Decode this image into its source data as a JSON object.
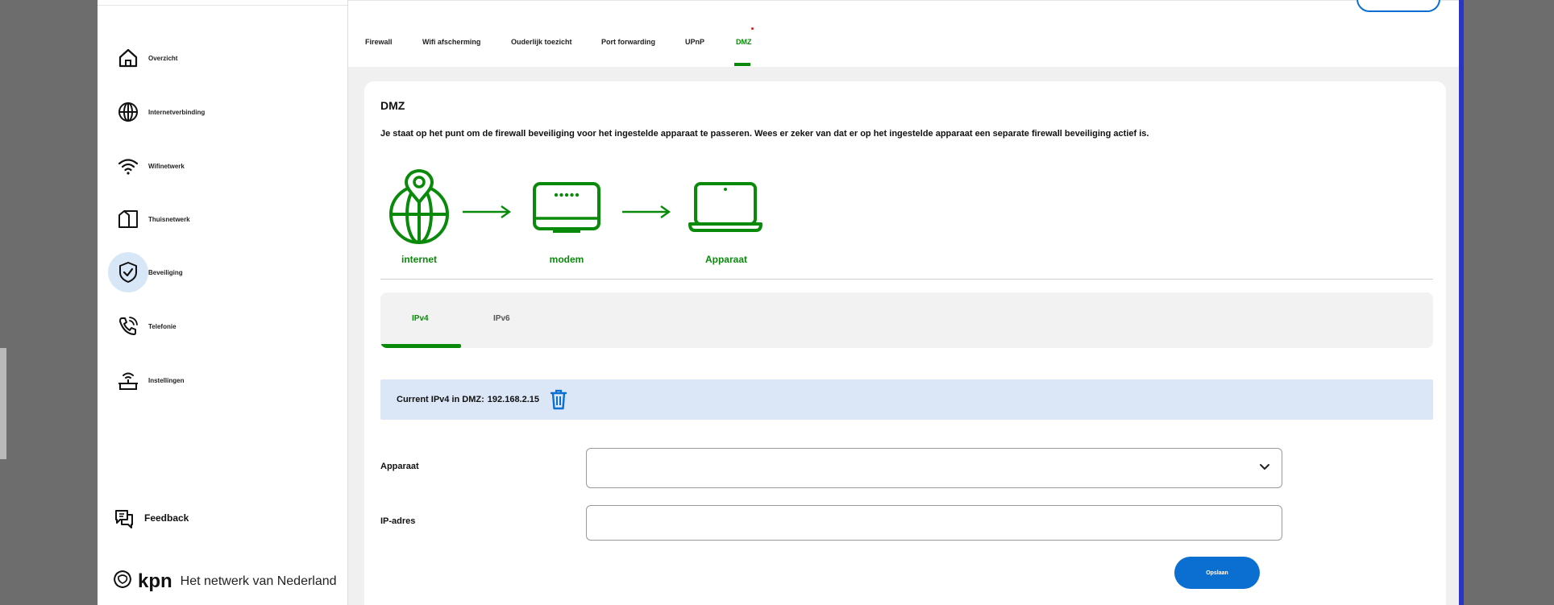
{
  "sidebar": {
    "items": [
      {
        "label": "Overzicht",
        "icon": "home-icon",
        "active": false
      },
      {
        "label": "Internetverbinding",
        "icon": "globe-icon",
        "active": false
      },
      {
        "label": "Wifinetwerk",
        "icon": "wifi-icon",
        "active": false
      },
      {
        "label": "Thuisnetwerk",
        "icon": "home-network-icon",
        "active": false
      },
      {
        "label": "Beveiliging",
        "icon": "shield-check-icon",
        "active": true
      },
      {
        "label": "Telefonie",
        "icon": "phone-icon",
        "active": false
      },
      {
        "label": "Instellingen",
        "icon": "router-settings-icon",
        "active": false
      }
    ],
    "feedback_label": "Feedback",
    "brand": {
      "logo": "kpn",
      "tagline": "Het netwerk van Nederland"
    }
  },
  "tabs": [
    {
      "label": "Firewall",
      "active": false
    },
    {
      "label": "Wifi afscherming",
      "active": false
    },
    {
      "label": "Ouderlijk toezicht",
      "active": false
    },
    {
      "label": "Port forwarding",
      "active": false
    },
    {
      "label": "UPnP",
      "active": false
    },
    {
      "label": "DMZ",
      "active": true
    }
  ],
  "card": {
    "title": "DMZ",
    "description": "Je staat op het punt om de firewall beveiliging voor het ingestelde apparaat te passeren. Wees er zeker van dat er op het ingestelde apparaat een separate firewall beveiliging actief is.",
    "diagram": {
      "internet_label": "internet",
      "modem_label": "modem",
      "device_label": "Apparaat"
    },
    "ip_tabs": [
      {
        "label": "IPv4",
        "active": true
      },
      {
        "label": "IPv6",
        "active": false
      }
    ],
    "current": {
      "label": "Current IPv4 in DMZ:",
      "value": "192.168.2.15"
    },
    "form": {
      "device_label": "Apparaat",
      "device_value": "",
      "ip_label": "IP-adres",
      "ip_value": ""
    },
    "save_label": "Opslaan"
  },
  "colors": {
    "accent_green": "#0a8a0a",
    "accent_blue": "#0a6fd0",
    "banner_bg": "#dbe7f6"
  }
}
